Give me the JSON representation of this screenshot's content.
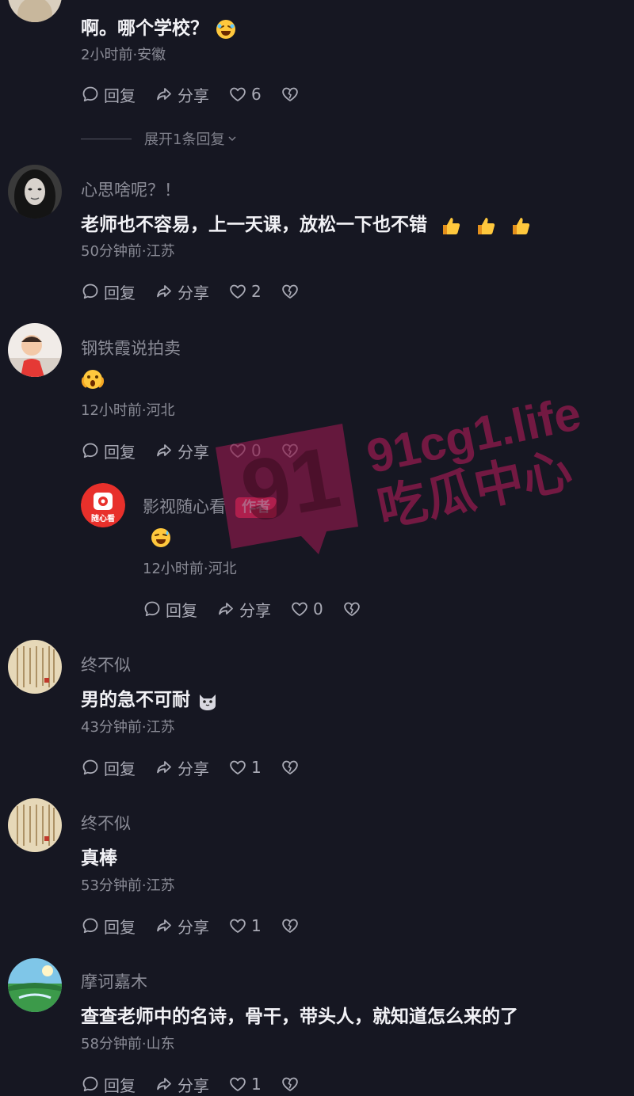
{
  "actions": {
    "reply_label": "回复",
    "share_label": "分享"
  },
  "comments": [
    {
      "content": "啊。哪个学校？",
      "meta": "2小时前·安徽",
      "likes": "6"
    },
    {
      "username": "心思啥呢？！",
      "content": "老师也不容易，上一天课，放松一下也不错",
      "meta": "50分钟前·江苏",
      "likes": "2"
    },
    {
      "username": "钢铁霞说拍卖",
      "meta": "12小时前·河北",
      "likes": "0"
    },
    {
      "username": "终不似",
      "content": "男的急不可耐",
      "meta": "43分钟前·江苏",
      "likes": "1"
    },
    {
      "username": "终不似",
      "content": "真棒",
      "meta": "53分钟前·江苏",
      "likes": "1"
    },
    {
      "username": "摩诃嘉木",
      "content": "查查老师中的名诗，骨干，带头人，就知道怎么来的了",
      "meta": "58分钟前·山东",
      "likes": "1"
    }
  ],
  "expand_replies": "展开1条回复",
  "reply": {
    "username": "影视随心看",
    "author_badge": "作者",
    "avatar_text": "随心看",
    "meta": "12小时前·河北",
    "likes": "0"
  },
  "watermark": {
    "number": "91",
    "domain": "91cg1.life",
    "name": "吃瓜中心"
  },
  "colors": {
    "background": "#161722",
    "text_primary": "#f2f2f6",
    "text_secondary": "#8b8c97",
    "author_badge": "#fe2c55",
    "watermark": "#8b1a4a"
  }
}
